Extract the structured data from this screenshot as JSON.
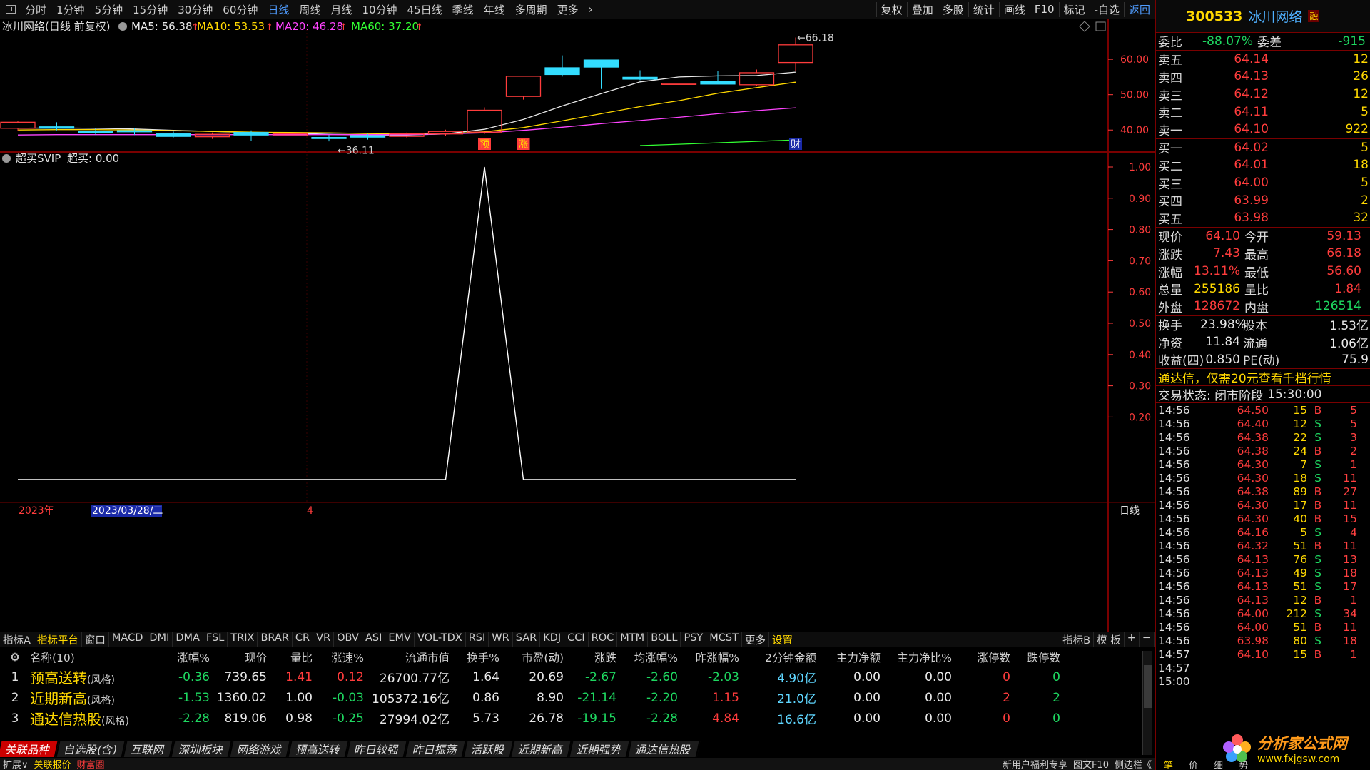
{
  "toolbar": {
    "periods": [
      "分时",
      "1分钟",
      "5分钟",
      "15分钟",
      "30分钟",
      "60分钟",
      "日线",
      "周线",
      "月线",
      "10分钟",
      "45日线",
      "季线",
      "年线",
      "多周期",
      "更多"
    ],
    "active_period": "日线",
    "tools": [
      "复权",
      "叠加",
      "多股",
      "统计",
      "画线",
      "F10",
      "标记",
      "-自选",
      "返回"
    ]
  },
  "main_chart": {
    "title": "冰川网络(日线 前复权)",
    "ma5": "MA5: 56.38",
    "ma10": "MA10: 53.53",
    "ma20": "MA20: 46.28",
    "ma60": "MA60: 37.20",
    "high_label": "66.18",
    "low_label": "36.11",
    "y_ticks": [
      "60.00",
      "50.00",
      "40.00"
    ],
    "markers": [
      "预",
      "涨",
      "财"
    ]
  },
  "indicator_chart": {
    "title": "超买SVIP",
    "value": "超买: 0.00",
    "y_ticks": [
      "1.00",
      "0.90",
      "0.80",
      "0.70",
      "0.60",
      "0.50",
      "0.40",
      "0.30",
      "0.20"
    ]
  },
  "time_axis": {
    "year": "2023年",
    "cursor_date": "2023/03/28/二",
    "month": "4",
    "period": "日线"
  },
  "indicator_bar": {
    "items": [
      "指标A",
      "指标平台",
      "窗口",
      "MACD",
      "DMI",
      "DMA",
      "FSL",
      "TRIX",
      "BRAR",
      "CR",
      "VR",
      "OBV",
      "ASI",
      "EMV",
      "VOL-TDX",
      "RSI",
      "WR",
      "SAR",
      "KDJ",
      "CCI",
      "ROC",
      "MTM",
      "BOLL",
      "PSY",
      "MCST",
      "更多",
      "设置"
    ],
    "right": [
      "指标B",
      "模 板",
      "+",
      "−"
    ]
  },
  "table": {
    "headers": [
      "名称(10)",
      "涨幅%",
      "现价",
      "量比",
      "涨速%",
      "流通市值",
      "换手%",
      "市盈(动)",
      "涨跌",
      "均涨幅%",
      "昨涨幅%",
      "2分钟金额",
      "主力净额",
      "主力净比%",
      "涨停数",
      "跌停数"
    ],
    "rows": [
      {
        "no": "1",
        "name": "预高送转",
        "tag": "(风格)",
        "chg": "-0.36",
        "price": "739.65",
        "vr": "1.41",
        "spd": "0.12",
        "mcap": "26700.77亿",
        "turn": "1.64",
        "pe": "20.69",
        "diff": "-2.67",
        "avg": "-2.60",
        "prev": "-2.03",
        "amt2": "4.90亿",
        "mnet": "0.00",
        "mratio": "0.00",
        "up": "0",
        "down": "0"
      },
      {
        "no": "2",
        "name": "近期新高",
        "tag": "(风格)",
        "chg": "-1.53",
        "price": "1360.02",
        "vr": "1.00",
        "spd": "-0.03",
        "mcap": "105372.16亿",
        "turn": "0.86",
        "pe": "8.90",
        "diff": "-21.14",
        "avg": "-2.20",
        "prev": "1.15",
        "amt2": "21.0亿",
        "mnet": "0.00",
        "mratio": "0.00",
        "up": "2",
        "down": "2"
      },
      {
        "no": "3",
        "name": "通达信热股",
        "tag": "(风格)",
        "chg": "-2.28",
        "price": "819.06",
        "vr": "0.98",
        "spd": "-0.25",
        "mcap": "27994.02亿",
        "turn": "5.73",
        "pe": "26.78",
        "diff": "-19.15",
        "avg": "-2.28",
        "prev": "4.84",
        "amt2": "16.6亿",
        "mnet": "0.00",
        "mratio": "0.00",
        "up": "0",
        "down": "0"
      }
    ]
  },
  "tabs": [
    "关联品种",
    "自选股(含)",
    "互联网",
    "深圳板块",
    "网络游戏",
    "预高送转",
    "昨日较强",
    "昨日振荡",
    "活跃股",
    "近期新高",
    "近期强势",
    "通达信热股"
  ],
  "status_bar": {
    "items": [
      "扩展∨",
      "关联报价",
      "财富圈"
    ],
    "right": [
      "新用户福利专享",
      "图文F10",
      "侧边栏《"
    ]
  },
  "quote": {
    "code": "300533",
    "name": "冰川网络",
    "badge": "融",
    "weibi_label": "委比",
    "weibi": "-88.07%",
    "weicha_label": "委差",
    "weicha": "-915",
    "asks": [
      {
        "label": "卖五",
        "price": "64.14",
        "vol": "12"
      },
      {
        "label": "卖四",
        "price": "64.13",
        "vol": "26"
      },
      {
        "label": "卖三",
        "price": "64.12",
        "vol": "12"
      },
      {
        "label": "卖二",
        "price": "64.11",
        "vol": "5"
      },
      {
        "label": "卖一",
        "price": "64.10",
        "vol": "922"
      }
    ],
    "bids": [
      {
        "label": "买一",
        "price": "64.02",
        "vol": "5"
      },
      {
        "label": "买二",
        "price": "64.01",
        "vol": "18"
      },
      {
        "label": "买三",
        "price": "64.00",
        "vol": "5"
      },
      {
        "label": "买四",
        "price": "63.99",
        "vol": "2"
      },
      {
        "label": "买五",
        "price": "63.98",
        "vol": "32"
      }
    ],
    "stats": [
      {
        "l1": "现价",
        "v1": "64.10",
        "c1": "red",
        "l2": "今开",
        "v2": "59.13",
        "c2": "red"
      },
      {
        "l1": "涨跌",
        "v1": "7.43",
        "c1": "red",
        "l2": "最高",
        "v2": "66.18",
        "c2": "red"
      },
      {
        "l1": "涨幅",
        "v1": "13.11%",
        "c1": "red",
        "l2": "最低",
        "v2": "56.60",
        "c2": "red"
      },
      {
        "l1": "总量",
        "v1": "255186",
        "c1": "yellow",
        "l2": "量比",
        "v2": "1.84",
        "c2": "red"
      },
      {
        "l1": "外盘",
        "v1": "128672",
        "c1": "red",
        "l2": "内盘",
        "v2": "126514",
        "c2": "green"
      }
    ],
    "fund": [
      {
        "l1": "换手",
        "v1": "23.98%",
        "l2": "股本",
        "v2": "1.53亿"
      },
      {
        "l1": "净资",
        "v1": "11.84",
        "l2": "流通",
        "v2": "1.06亿"
      },
      {
        "l1": "收益(四)",
        "v1": "0.850",
        "l2": "PE(动)",
        "v2": "75.9"
      }
    ],
    "ad": "通达信，仅需20元查看千档行情",
    "status_label": "交易状态: 闭市阶段",
    "status_time": "15:30:00",
    "ticks": [
      {
        "t": "14:56",
        "p": "64.50",
        "v": "15",
        "d": "B",
        "n": "5"
      },
      {
        "t": "14:56",
        "p": "64.40",
        "v": "12",
        "d": "S",
        "n": "5"
      },
      {
        "t": "14:56",
        "p": "64.38",
        "v": "22",
        "d": "S",
        "n": "3"
      },
      {
        "t": "14:56",
        "p": "64.38",
        "v": "24",
        "d": "B",
        "n": "2"
      },
      {
        "t": "14:56",
        "p": "64.30",
        "v": "7",
        "d": "S",
        "n": "1"
      },
      {
        "t": "14:56",
        "p": "64.30",
        "v": "18",
        "d": "S",
        "n": "11"
      },
      {
        "t": "14:56",
        "p": "64.38",
        "v": "89",
        "d": "B",
        "n": "27"
      },
      {
        "t": "14:56",
        "p": "64.30",
        "v": "17",
        "d": "B",
        "n": "11"
      },
      {
        "t": "14:56",
        "p": "64.30",
        "v": "40",
        "d": "B",
        "n": "15"
      },
      {
        "t": "14:56",
        "p": "64.16",
        "v": "5",
        "d": "S",
        "n": "4"
      },
      {
        "t": "14:56",
        "p": "64.32",
        "v": "51",
        "d": "B",
        "n": "11"
      },
      {
        "t": "14:56",
        "p": "64.13",
        "v": "76",
        "d": "S",
        "n": "13"
      },
      {
        "t": "14:56",
        "p": "64.13",
        "v": "49",
        "d": "S",
        "n": "18"
      },
      {
        "t": "14:56",
        "p": "64.13",
        "v": "51",
        "d": "S",
        "n": "17"
      },
      {
        "t": "14:56",
        "p": "64.13",
        "v": "12",
        "d": "B",
        "n": "1"
      },
      {
        "t": "14:56",
        "p": "64.00",
        "v": "212",
        "d": "S",
        "n": "34"
      },
      {
        "t": "14:56",
        "p": "64.00",
        "v": "51",
        "d": "B",
        "n": "11"
      },
      {
        "t": "14:56",
        "p": "63.98",
        "v": "80",
        "d": "S",
        "n": "18"
      },
      {
        "t": "14:57",
        "p": "64.10",
        "v": "15",
        "d": "B",
        "n": "1"
      },
      {
        "t": "14:57",
        "p": "",
        "v": "",
        "d": "",
        "n": ""
      },
      {
        "t": "15:00",
        "p": "",
        "v": "",
        "d": "",
        "n": ""
      }
    ],
    "bottom_tabs": [
      "笔",
      "价",
      "细",
      "势"
    ]
  },
  "watermark": {
    "name": "分析家公式网",
    "url": "www.fxjgsw.com"
  },
  "colors": {
    "up": "#ff3c3c",
    "down": "#1ed760",
    "accent": "#ffd800",
    "frame": "#7a0000"
  },
  "chart_data": {
    "type": "line",
    "candles": [
      {
        "o": 40.5,
        "c": 42.2,
        "h": 42.6,
        "l": 39.8
      },
      {
        "o": 40.9,
        "c": 40.5,
        "h": 42.2,
        "l": 39.9
      },
      {
        "o": 39.6,
        "c": 39.2,
        "h": 40.4,
        "l": 38.6
      },
      {
        "o": 39.8,
        "c": 39.5,
        "h": 40.6,
        "l": 38.6
      },
      {
        "o": 38.9,
        "c": 38.2,
        "h": 39.6,
        "l": 37.9
      },
      {
        "o": 38.1,
        "c": 38.8,
        "h": 39.3,
        "l": 37.5
      },
      {
        "o": 39.3,
        "c": 38.6,
        "h": 39.9,
        "l": 36.9
      },
      {
        "o": 38.4,
        "c": 38.9,
        "h": 39.5,
        "l": 37.6
      },
      {
        "o": 37.9,
        "c": 37.6,
        "h": 38.6,
        "l": 36.8
      },
      {
        "o": 38.4,
        "c": 38.0,
        "h": 38.9,
        "l": 37.3
      },
      {
        "o": 38.2,
        "c": 38.9,
        "h": 39.3,
        "l": 37.9
      },
      {
        "o": 38.9,
        "c": 39.6,
        "h": 40.1,
        "l": 38.4
      },
      {
        "o": 39.4,
        "c": 45.6,
        "h": 46.4,
        "l": 38.9
      },
      {
        "o": 49.5,
        "c": 55.2,
        "h": 55.2,
        "l": 48.6
      },
      {
        "o": 57.6,
        "c": 55.7,
        "h": 61.1,
        "l": 55.1
      },
      {
        "o": 59.8,
        "c": 57.8,
        "h": 59.9,
        "l": 51.6
      },
      {
        "o": 54.9,
        "c": 54.4,
        "h": 56.9,
        "l": 54.1
      },
      {
        "o": 53.0,
        "c": 53.2,
        "h": 54.6,
        "l": 50.3
      },
      {
        "o": 53.8,
        "c": 53.0,
        "h": 56.6,
        "l": 53.0
      },
      {
        "o": 52.8,
        "c": 56.2,
        "h": 57.1,
        "l": 52.5
      },
      {
        "o": 59.1,
        "c": 64.1,
        "h": 66.18,
        "l": 56.6
      }
    ],
    "ma5": [
      40.5,
      40.6,
      40.5,
      40.3,
      39.9,
      39.6,
      39.3,
      39.1,
      38.8,
      38.6,
      38.6,
      38.9,
      40.2,
      43.0,
      46.8,
      50.3,
      53.6,
      55.0,
      55.3,
      55.4,
      56.38
    ],
    "ma10": [
      40.0,
      40.1,
      40.1,
      40.0,
      39.8,
      39.6,
      39.4,
      39.3,
      39.2,
      39.0,
      38.9,
      38.9,
      39.5,
      40.7,
      42.6,
      44.6,
      46.6,
      48.3,
      50.4,
      52.0,
      53.53
    ],
    "ma20": [
      38.6,
      38.7,
      38.7,
      38.7,
      38.7,
      38.7,
      38.7,
      38.7,
      38.7,
      38.7,
      38.7,
      38.9,
      39.2,
      39.9,
      40.8,
      41.8,
      42.7,
      43.6,
      44.6,
      45.5,
      46.28
    ],
    "ma60": [
      null,
      null,
      null,
      null,
      null,
      null,
      null,
      null,
      null,
      null,
      null,
      null,
      null,
      null,
      null,
      null,
      35.6,
      36.0,
      36.4,
      36.8,
      37.2
    ],
    "ylim": [
      34.6,
      68.5
    ],
    "indicator": [
      0,
      0,
      0,
      0,
      0,
      0,
      0,
      0,
      0,
      0,
      0,
      0,
      1,
      0,
      0,
      0,
      0,
      0,
      0,
      0,
      0
    ],
    "indicator_ylim": [
      0,
      1.0
    ]
  }
}
